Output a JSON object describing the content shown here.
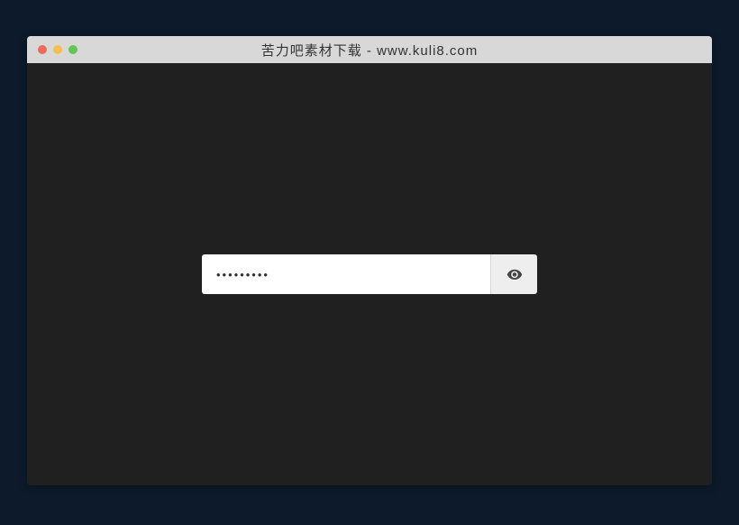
{
  "window": {
    "title": "苦力吧素材下载 - www.kuli8.com"
  },
  "password": {
    "value": "•••••••••"
  }
}
